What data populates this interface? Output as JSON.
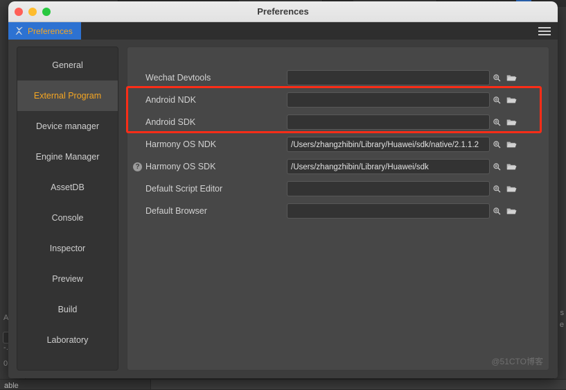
{
  "window": {
    "title": "Preferences",
    "traffic_lights": [
      "close-red",
      "minimize-yellow",
      "maximize-green"
    ]
  },
  "tabbar": {
    "tab_label": "Preferences",
    "tab_icon": "tools-wrench-icon",
    "menu_icon": "hamburger-menu-icon"
  },
  "sidebar": {
    "items": [
      {
        "label": "General",
        "active": false
      },
      {
        "label": "External Program",
        "active": true
      },
      {
        "label": "Device manager",
        "active": false
      },
      {
        "label": "Engine Manager",
        "active": false
      },
      {
        "label": "AssetDB",
        "active": false
      },
      {
        "label": "Console",
        "active": false
      },
      {
        "label": "Inspector",
        "active": false
      },
      {
        "label": "Preview",
        "active": false
      },
      {
        "label": "Build",
        "active": false
      },
      {
        "label": "Laboratory",
        "active": false
      }
    ]
  },
  "settings": {
    "rows": [
      {
        "label": "Wechat Devtools",
        "value": "",
        "placeholder": "",
        "help": false
      },
      {
        "label": "Android NDK",
        "value": "",
        "placeholder": "",
        "help": false
      },
      {
        "label": "Android SDK",
        "value": "",
        "placeholder": "",
        "help": false
      },
      {
        "label": "Harmony OS NDK",
        "value": "/Users/zhangzhibin/Library/Huawei/sdk/native/2.1.1.2",
        "placeholder": "",
        "help": false
      },
      {
        "label": "Harmony OS SDK",
        "value": "/Users/zhangzhibin/Library/Huawei/sdk",
        "placeholder": "",
        "help": true
      },
      {
        "label": "Default Script Editor",
        "value": "",
        "placeholder": "",
        "help": false
      },
      {
        "label": "Default Browser",
        "value": "",
        "placeholder": "",
        "help": false
      }
    ],
    "search_icon": "magnifier-icon",
    "browse_icon": "folder-open-icon",
    "help_icon": "question-mark-icon"
  },
  "annotation": {
    "highlight_color": "#fc2d17"
  },
  "watermark": {
    "text": "@51CTO博客"
  },
  "background": {
    "left_labels": [
      "A",
      "",
      "0 ("
    ],
    "bottom_label": "able"
  },
  "colors": {
    "accent_tab": "#2d72d2",
    "accent_text": "#f5a623",
    "panel_bg": "#474747",
    "sidebar_bg": "#333333",
    "window_bg": "#3c3c3c",
    "field_bg": "#333333"
  }
}
